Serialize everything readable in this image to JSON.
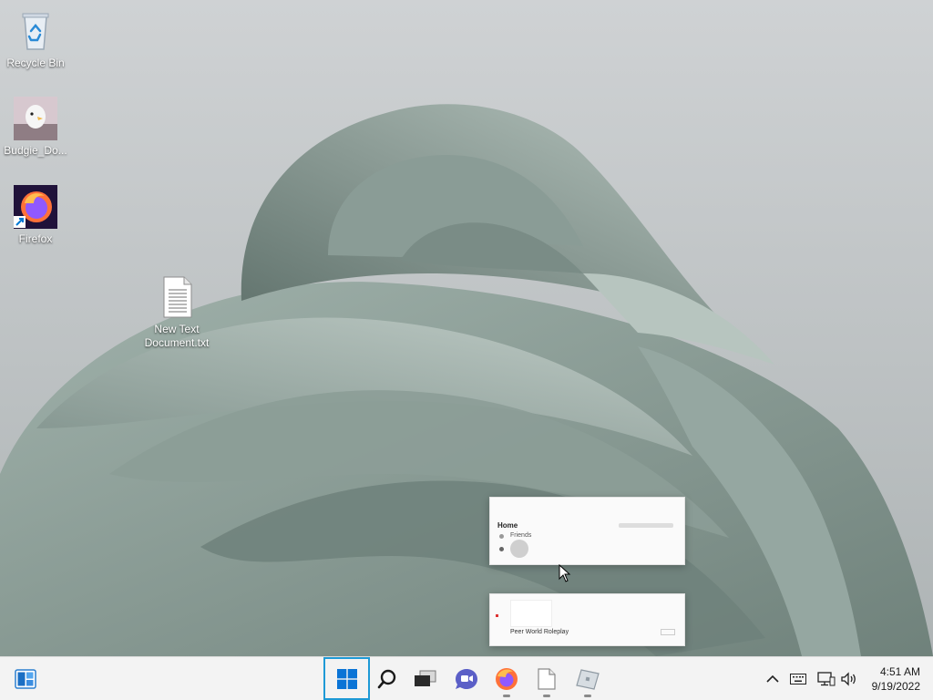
{
  "desktop": {
    "icons": [
      {
        "label": "Recycle Bin"
      },
      {
        "label": "Budgie_Do..."
      },
      {
        "label": "Firefox"
      },
      {
        "label": "New Text Document.txt"
      }
    ]
  },
  "preview": {
    "window1": {
      "title": "Home",
      "section": "Friends"
    },
    "window2": {
      "title": "Peer World Roleplay"
    }
  },
  "taskbar": {
    "pinned": [
      {
        "icon": "widgets-icon"
      },
      {
        "icon": "start-icon"
      },
      {
        "icon": "search-icon"
      },
      {
        "icon": "task-view-icon"
      },
      {
        "icon": "chat-icon"
      },
      {
        "icon": "firefox-icon"
      },
      {
        "icon": "notepad-icon"
      },
      {
        "icon": "roblox-icon"
      }
    ],
    "tray": {
      "time": "4:51 AM",
      "date": "9/19/2022"
    }
  },
  "colors": {
    "start_focus": "#1e9ad6",
    "windows_blue": "#0078d4"
  }
}
